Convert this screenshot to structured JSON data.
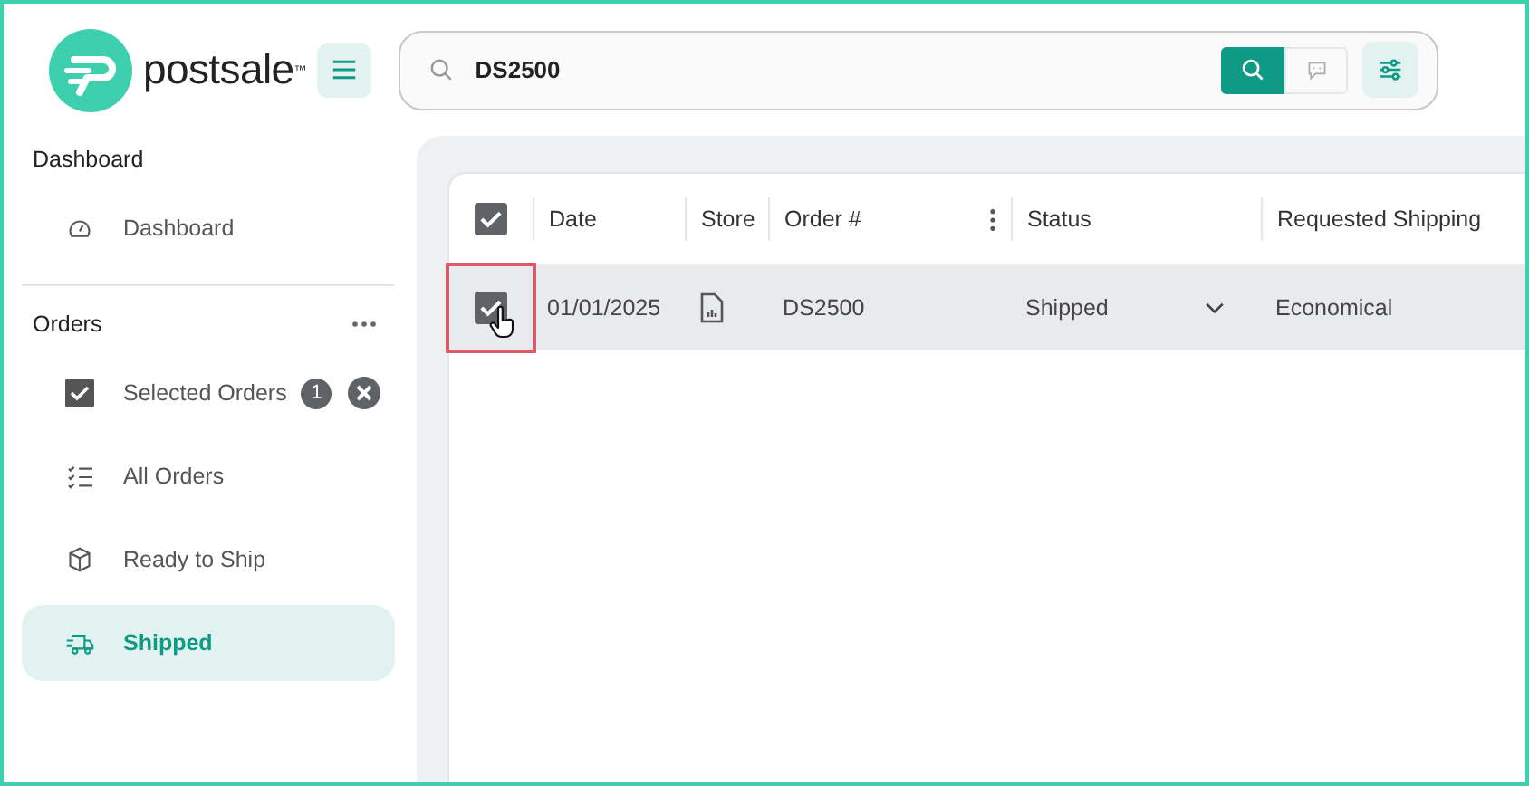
{
  "header": {
    "brand": "postsale",
    "trademark": "™",
    "search": {
      "value": "DS2500"
    }
  },
  "sidebar": {
    "sections": [
      {
        "title": "Dashboard",
        "has_menu": false,
        "items": [
          {
            "label": "Dashboard",
            "selected": false,
            "clearable": false
          }
        ]
      },
      {
        "title": "Orders",
        "has_menu": true,
        "items": [
          {
            "label": "Selected Orders",
            "selected": false,
            "count": "1",
            "clearable": true
          },
          {
            "label": "All Orders",
            "selected": false,
            "clearable": false
          },
          {
            "label": "Ready to Ship",
            "selected": false,
            "clearable": false
          },
          {
            "label": "Shipped",
            "selected": true,
            "clearable": false
          }
        ]
      }
    ]
  },
  "table": {
    "all_checked": true,
    "columns": [
      {
        "label": "Date",
        "kind": "plain"
      },
      {
        "label": "Store",
        "kind": "plain"
      },
      {
        "label": "Order #",
        "kind": "menu"
      },
      {
        "label": "Status",
        "kind": "plain"
      },
      {
        "label": "Requested Shipping",
        "kind": "plain"
      }
    ],
    "rows": [
      {
        "checked": true,
        "selected": true,
        "highlighted": true,
        "date": "01/01/2025",
        "order": "DS2500",
        "status": "Shipped",
        "shipping": "Economical"
      }
    ]
  }
}
